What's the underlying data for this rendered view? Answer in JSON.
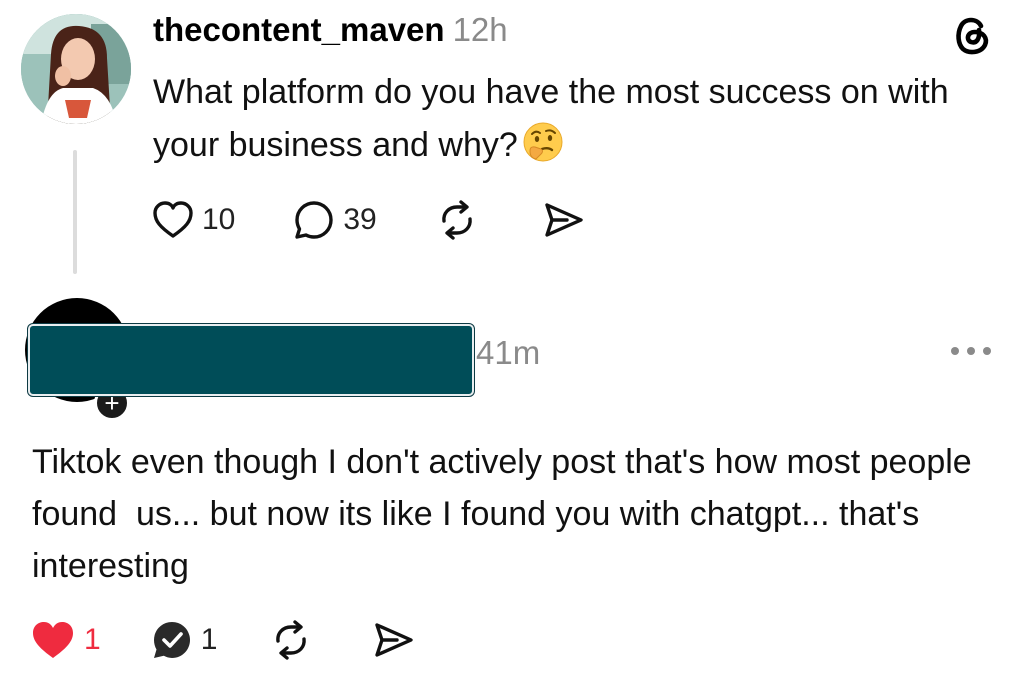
{
  "post": {
    "username": "thecontent_maven",
    "time": "12h",
    "text": "What platform do you have the most success on with your business and why?",
    "emoji": "thinking-face",
    "likes": "10",
    "replies": "39"
  },
  "reply": {
    "time": "41m",
    "text": "Tiktok even though I don't actively post that's how most people found  us... but now its like I found you with chatgpt... that's interesting",
    "likes": "1",
    "replies": "1",
    "liked": true,
    "like_color": "#ef2b3f"
  },
  "icons": [
    "threads-logo",
    "heart-icon",
    "comment-icon",
    "repost-icon",
    "share-icon",
    "more-icon",
    "follow-plus-icon"
  ]
}
